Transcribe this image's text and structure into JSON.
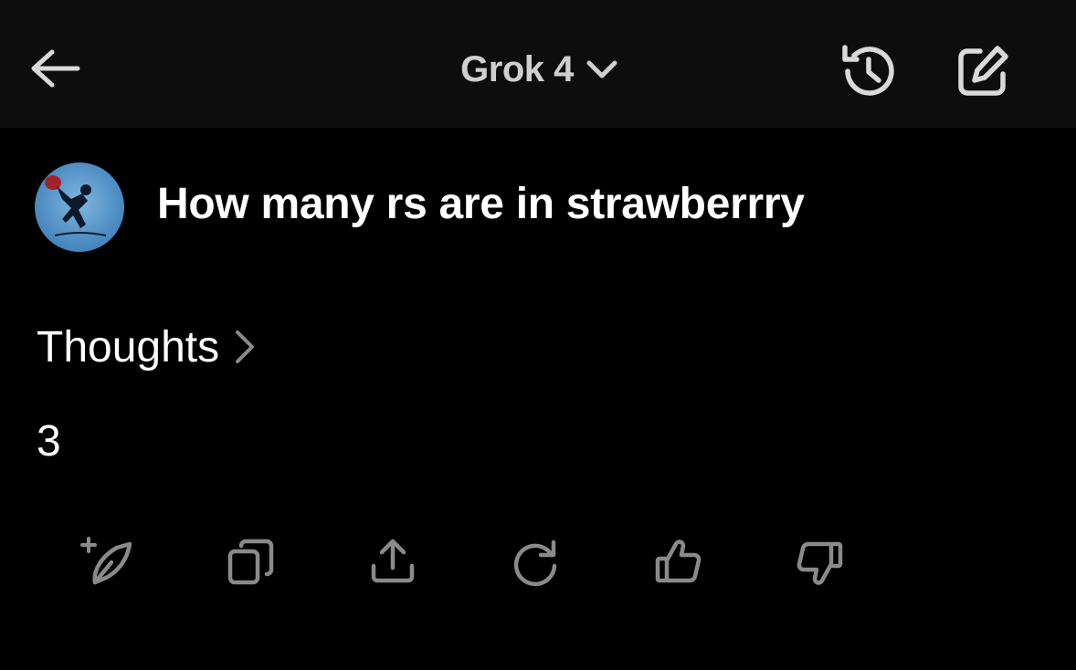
{
  "header": {
    "model_label": "Grok 4",
    "icons": {
      "back": "arrow-left-icon",
      "model_dropdown": "chevron-down-icon",
      "history": "history-icon",
      "compose": "compose-icon"
    }
  },
  "conversation": {
    "user_message": "How many rs are in strawberrry",
    "avatar": "user-avatar",
    "thoughts_label": "Thoughts",
    "answer": "3"
  },
  "actions": [
    {
      "icon": "new-thread-icon"
    },
    {
      "icon": "copy-icon"
    },
    {
      "icon": "share-icon"
    },
    {
      "icon": "regenerate-icon"
    },
    {
      "icon": "thumbs-up-icon"
    },
    {
      "icon": "thumbs-down-icon"
    }
  ],
  "colors": {
    "background": "#000000",
    "topbar": "#0d0d0d",
    "icon_gray": "#8a8a8a",
    "header_icon": "#d9d9d9"
  }
}
